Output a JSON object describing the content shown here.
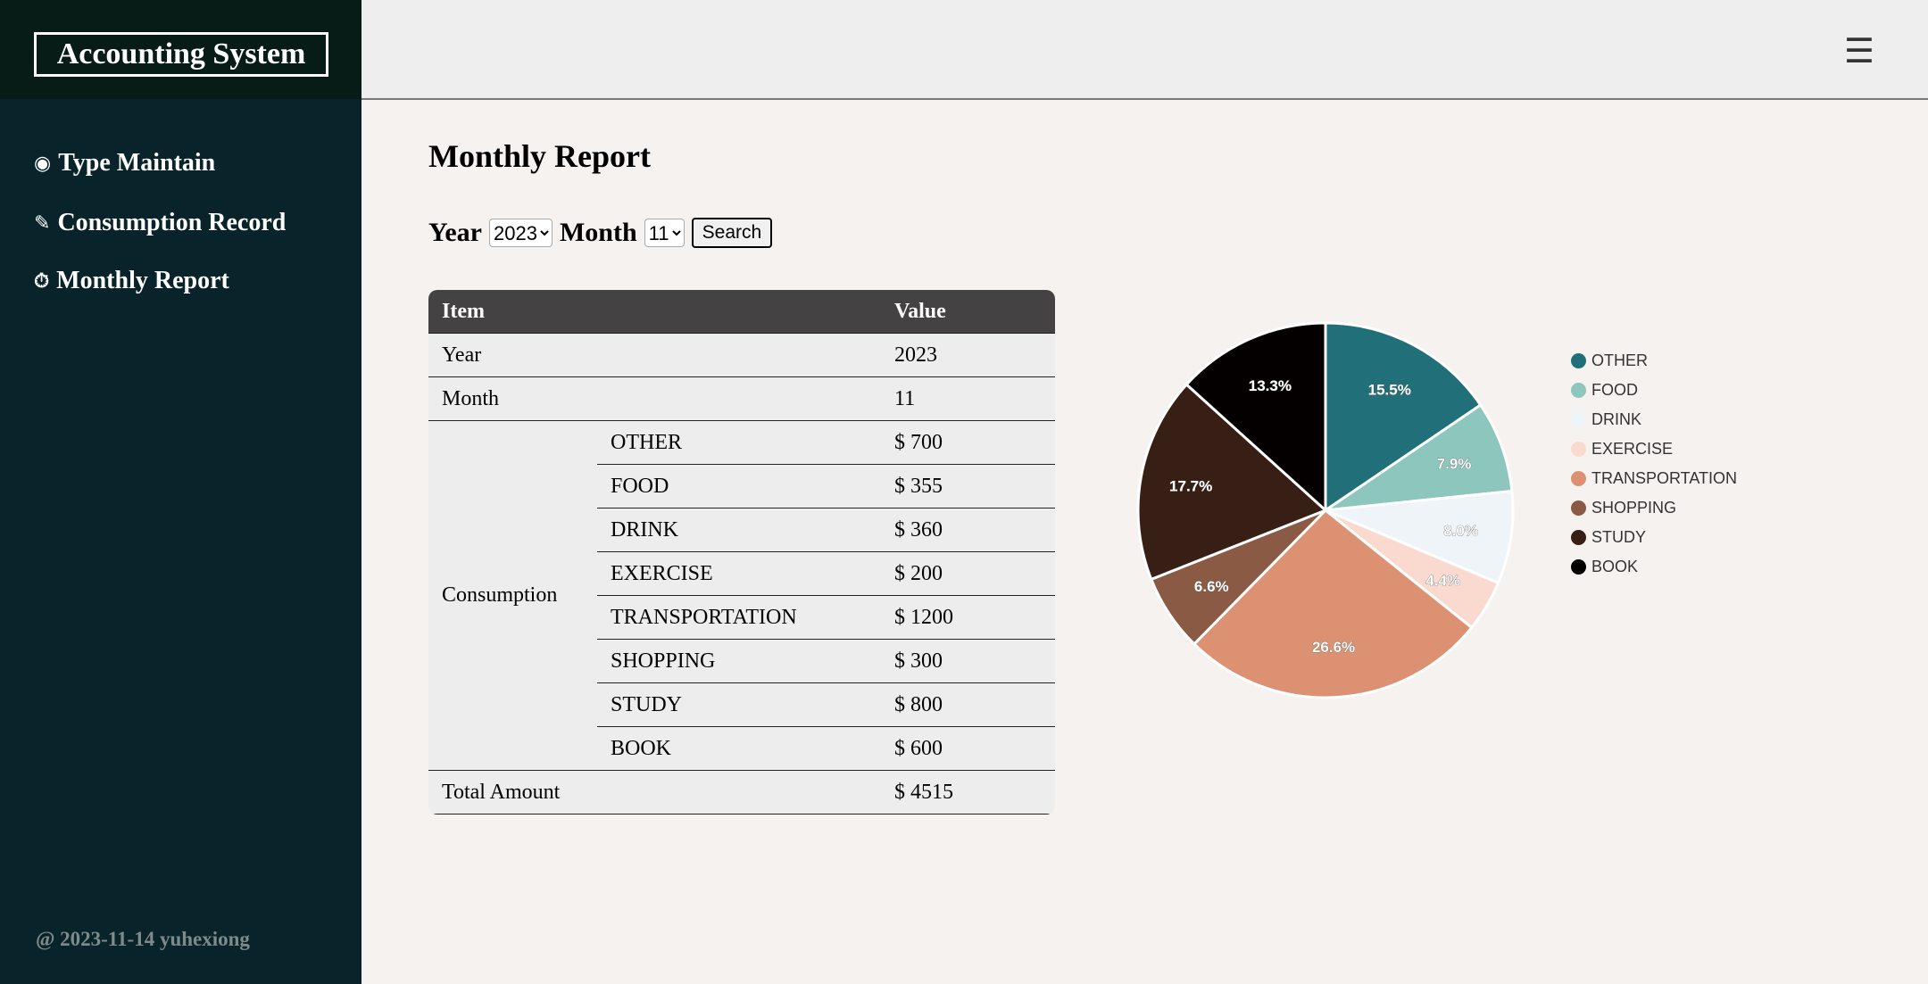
{
  "brand": {
    "title": "Accounting System"
  },
  "sidebar": {
    "items": [
      {
        "icon": "◉",
        "label": "Type Maintain"
      },
      {
        "icon": "✎",
        "label": "Consumption Record"
      },
      {
        "icon": "⏱",
        "label": "Monthly Report"
      }
    ],
    "footer": "@ 2023-11-14 yuhexiong"
  },
  "topbar": {
    "menu_icon": "☰"
  },
  "page": {
    "title": "Monthly Report"
  },
  "filter": {
    "year_label": "Year",
    "year_value": "2023",
    "month_label": "Month",
    "month_value": "11",
    "search_label": "Search"
  },
  "table": {
    "headers": [
      "Item",
      "Value"
    ],
    "year_label": "Year",
    "year_value": "2023",
    "month_label": "Month",
    "month_value": "11",
    "consumption_label": "Consumption",
    "rows": [
      {
        "type": "OTHER",
        "value": "$ 700"
      },
      {
        "type": "FOOD",
        "value": "$ 355"
      },
      {
        "type": "DRINK",
        "value": "$ 360"
      },
      {
        "type": "EXERCISE",
        "value": "$ 200"
      },
      {
        "type": "TRANSPORTATION",
        "value": "$ 1200"
      },
      {
        "type": "SHOPPING",
        "value": "$ 300"
      },
      {
        "type": "STUDY",
        "value": "$ 800"
      },
      {
        "type": "BOOK",
        "value": "$ 600"
      }
    ],
    "total_label": "Total Amount",
    "total_value": "$ 4515"
  },
  "chart_data": {
    "type": "pie",
    "categories": [
      "OTHER",
      "FOOD",
      "DRINK",
      "EXERCISE",
      "TRANSPORTATION",
      "SHOPPING",
      "STUDY",
      "BOOK"
    ],
    "values": [
      700,
      355,
      360,
      200,
      1200,
      300,
      800,
      600
    ],
    "labels": [
      "15.5%",
      "7.9%",
      "8.0%",
      "4.4%",
      "26.6%",
      "6.6%",
      "17.7%",
      "13.3%"
    ],
    "colors": [
      "#216f78",
      "#8cc6bd",
      "#eef4f8",
      "#fadacf",
      "#dc9272",
      "#8b5a44",
      "#371f16",
      "#040000"
    ],
    "legend": "right"
  }
}
